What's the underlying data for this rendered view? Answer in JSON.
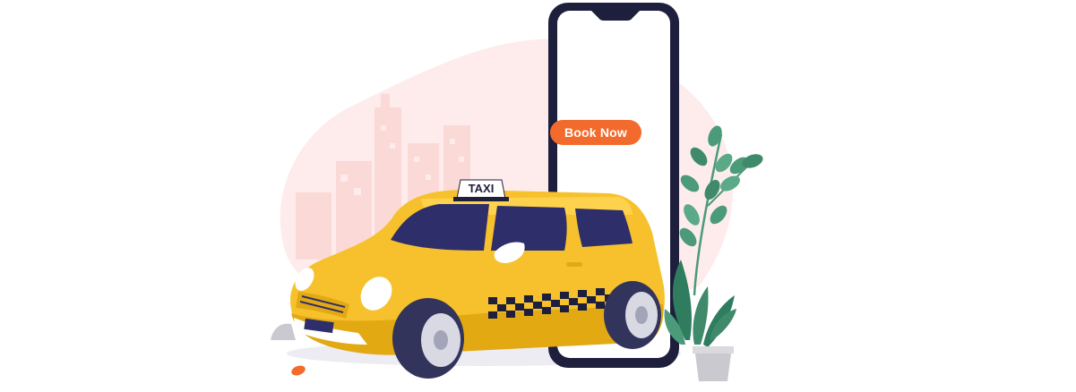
{
  "illustration": {
    "phone_button_label": "Book Now",
    "taxi_sign_label": "TAXI"
  },
  "colors": {
    "accent": "#f26b2c",
    "taxi_yellow": "#f6c12c",
    "taxi_yellow_dark": "#e3a913",
    "background_blob": "#fdeceb",
    "phone_frame": "#1d1f3d",
    "plant_green": "#4b9a79"
  },
  "icons": [
    "taxi-car-icon",
    "smartphone-icon",
    "potted-plant-icon",
    "leaf-icon",
    "city-skyline-icon"
  ]
}
